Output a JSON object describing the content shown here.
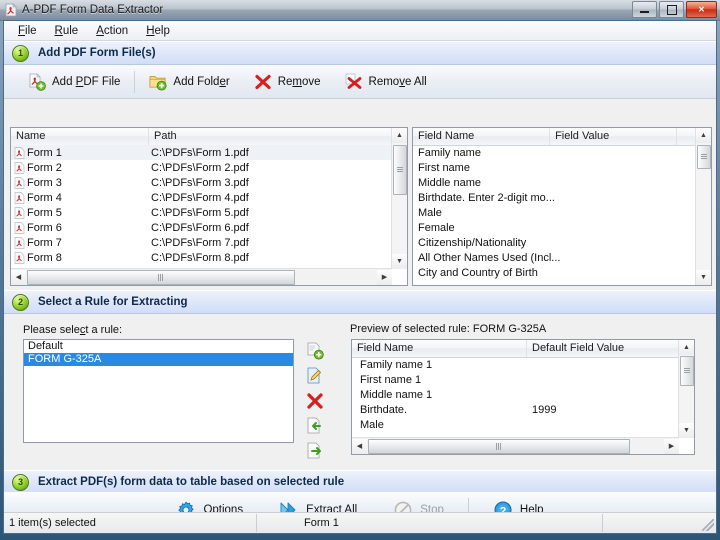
{
  "window": {
    "title": "A-PDF Form Data Extractor",
    "icon": "pdf-icon",
    "controls": {
      "minimize": "Minimize",
      "maximize": "Maximize",
      "close": "Close"
    }
  },
  "menu": {
    "items": [
      {
        "label": "File",
        "accel": "F"
      },
      {
        "label": "Rule",
        "accel": "R"
      },
      {
        "label": "Action",
        "accel": "A"
      },
      {
        "label": "Help",
        "accel": "H"
      }
    ]
  },
  "step1": {
    "number": "1",
    "title": "Add PDF Form File(s)",
    "toolbar": [
      {
        "label": "Add PDF File",
        "accel": "P",
        "icon": "add-pdf-icon"
      },
      {
        "label": "Add Folder",
        "accel": "e",
        "icon": "add-folder-icon"
      },
      {
        "label": "Remove",
        "accel": "m",
        "icon": "remove-icon"
      },
      {
        "label": "Remove All",
        "accel": "v",
        "icon": "remove-all-icon"
      }
    ],
    "file_list": {
      "columns": [
        "Name",
        "Path"
      ],
      "rows": [
        {
          "name": "Form 1",
          "path": "C:\\PDFs\\Form 1.pdf",
          "selected": true
        },
        {
          "name": "Form 2",
          "path": "C:\\PDFs\\Form 2.pdf",
          "selected": false
        },
        {
          "name": "Form 3",
          "path": "C:\\PDFs\\Form 3.pdf",
          "selected": false
        },
        {
          "name": "Form 4",
          "path": "C:\\PDFs\\Form 4.pdf",
          "selected": false
        },
        {
          "name": "Form 5",
          "path": "C:\\PDFs\\Form 5.pdf",
          "selected": false
        },
        {
          "name": "Form 6",
          "path": "C:\\PDFs\\Form 6.pdf",
          "selected": false
        },
        {
          "name": "Form 7",
          "path": "C:\\PDFs\\Form 7.pdf",
          "selected": false
        },
        {
          "name": "Form 8",
          "path": "C:\\PDFs\\Form 8.pdf",
          "selected": false
        }
      ]
    },
    "field_list": {
      "columns": [
        "Field Name",
        "Field Value",
        ""
      ],
      "rows": [
        {
          "field_name": "Family name",
          "field_value": ""
        },
        {
          "field_name": "First name",
          "field_value": ""
        },
        {
          "field_name": "Middle name",
          "field_value": ""
        },
        {
          "field_name": "Birthdate.  Enter 2-digit mo...",
          "field_value": ""
        },
        {
          "field_name": "Male",
          "field_value": ""
        },
        {
          "field_name": "Female",
          "field_value": ""
        },
        {
          "field_name": "Citizenship/Nationality",
          "field_value": ""
        },
        {
          "field_name": "All Other Names Used (Incl...",
          "field_value": ""
        },
        {
          "field_name": "City and Country of Birth",
          "field_value": ""
        }
      ]
    }
  },
  "step2": {
    "number": "2",
    "title": "Select a Rule for Extracting",
    "rule_label": "Please select a rule:",
    "rule_label_accel": "c",
    "rules": [
      {
        "label": "Default",
        "selected": false
      },
      {
        "label": "FORM G-325A",
        "selected": true
      }
    ],
    "rule_buttons": [
      {
        "name": "new-rule-button",
        "icon": "new-rule-icon"
      },
      {
        "name": "edit-rule-button",
        "icon": "edit-rule-icon"
      },
      {
        "name": "delete-rule-button",
        "icon": "delete-rule-icon"
      },
      {
        "name": "import-rule-button",
        "icon": "import-rule-icon"
      },
      {
        "name": "export-rule-button",
        "icon": "export-rule-icon"
      }
    ],
    "preview_label": "Preview of selected rule: FORM G-325A",
    "preview": {
      "columns": [
        "Field Name",
        "Default Field Value"
      ],
      "rows": [
        {
          "field_name": "Family name 1",
          "default_value": ""
        },
        {
          "field_name": "First name 1",
          "default_value": ""
        },
        {
          "field_name": "Middle name 1",
          "default_value": ""
        },
        {
          "field_name": "Birthdate.",
          "default_value": "1999"
        },
        {
          "field_name": "Male",
          "default_value": ""
        }
      ]
    }
  },
  "step3": {
    "number": "3",
    "title": "Extract PDF(s) form data to table based on selected rule",
    "buttons": [
      {
        "label": "Options",
        "accel": "",
        "icon": "options-gear-icon",
        "disabled": false
      },
      {
        "label": "Extract All",
        "accel": "E",
        "icon": "extract-all-icon",
        "disabled": false
      },
      {
        "label": "Stop",
        "accel": "",
        "icon": "stop-icon",
        "disabled": true
      },
      {
        "label": "Help",
        "accel": "",
        "icon": "help-icon",
        "disabled": false
      }
    ]
  },
  "statusbar": {
    "left": "1 item(s) selected",
    "middle": "Form 1",
    "right": ""
  },
  "colors": {
    "accent": "#2a8ae2",
    "step_header_bg": "#dde6f8",
    "window_frame": "#2d5575",
    "list_bg": "#ffffff"
  }
}
